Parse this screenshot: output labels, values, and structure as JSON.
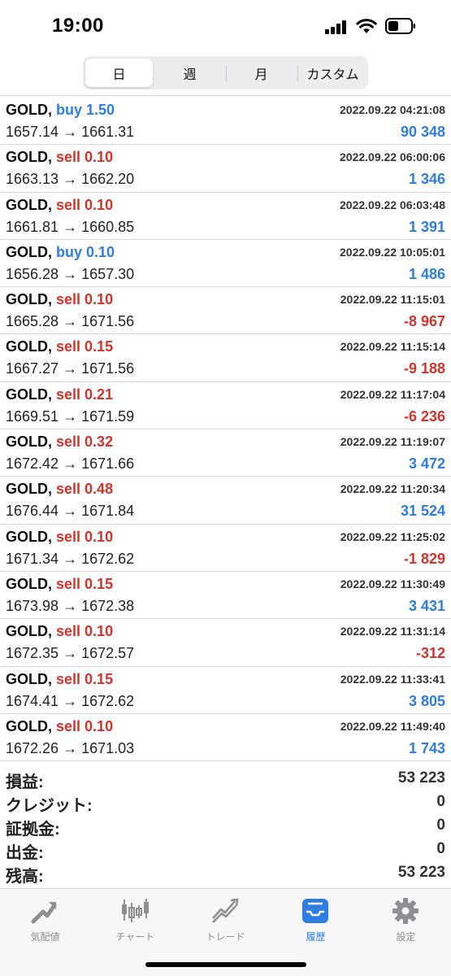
{
  "status": {
    "time": "19:00"
  },
  "period_tabs": [
    {
      "label": "日",
      "active": true
    },
    {
      "label": "週",
      "active": false
    },
    {
      "label": "月",
      "active": false
    },
    {
      "label": "カスタム",
      "active": false
    }
  ],
  "deals": [
    {
      "symbol": "GOLD,",
      "type": "buy",
      "volume": "buy 1.50",
      "prices": "1657.14 → 1661.31",
      "time": "2022.09.22 04:21:08",
      "profit": "90 348",
      "sign": "pos"
    },
    {
      "symbol": "GOLD,",
      "type": "sell",
      "volume": "sell 0.10",
      "prices": "1663.13 → 1662.20",
      "time": "2022.09.22 06:00:06",
      "profit": "1 346",
      "sign": "pos"
    },
    {
      "symbol": "GOLD,",
      "type": "sell",
      "volume": "sell 0.10",
      "prices": "1661.81 → 1660.85",
      "time": "2022.09.22 06:03:48",
      "profit": "1 391",
      "sign": "pos"
    },
    {
      "symbol": "GOLD,",
      "type": "buy",
      "volume": "buy 0.10",
      "prices": "1656.28 → 1657.30",
      "time": "2022.09.22 10:05:01",
      "profit": "1 486",
      "sign": "pos"
    },
    {
      "symbol": "GOLD,",
      "type": "sell",
      "volume": "sell 0.10",
      "prices": "1665.28 → 1671.56",
      "time": "2022.09.22 11:15:01",
      "profit": "-8 967",
      "sign": "neg"
    },
    {
      "symbol": "GOLD,",
      "type": "sell",
      "volume": "sell 0.15",
      "prices": "1667.27 → 1671.56",
      "time": "2022.09.22 11:15:14",
      "profit": "-9 188",
      "sign": "neg"
    },
    {
      "symbol": "GOLD,",
      "type": "sell",
      "volume": "sell 0.21",
      "prices": "1669.51 → 1671.59",
      "time": "2022.09.22 11:17:04",
      "profit": "-6 236",
      "sign": "neg"
    },
    {
      "symbol": "GOLD,",
      "type": "sell",
      "volume": "sell 0.32",
      "prices": "1672.42 → 1671.66",
      "time": "2022.09.22 11:19:07",
      "profit": "3 472",
      "sign": "pos"
    },
    {
      "symbol": "GOLD,",
      "type": "sell",
      "volume": "sell 0.48",
      "prices": "1676.44 → 1671.84",
      "time": "2022.09.22 11:20:34",
      "profit": "31 524",
      "sign": "pos"
    },
    {
      "symbol": "GOLD,",
      "type": "sell",
      "volume": "sell 0.10",
      "prices": "1671.34 → 1672.62",
      "time": "2022.09.22 11:25:02",
      "profit": "-1 829",
      "sign": "neg"
    },
    {
      "symbol": "GOLD,",
      "type": "sell",
      "volume": "sell 0.15",
      "prices": "1673.98 → 1672.38",
      "time": "2022.09.22 11:30:49",
      "profit": "3 431",
      "sign": "pos"
    },
    {
      "symbol": "GOLD,",
      "type": "sell",
      "volume": "sell 0.10",
      "prices": "1672.35 → 1672.57",
      "time": "2022.09.22 11:31:14",
      "profit": "-312",
      "sign": "neg"
    },
    {
      "symbol": "GOLD,",
      "type": "sell",
      "volume": "sell 0.15",
      "prices": "1674.41 → 1672.62",
      "time": "2022.09.22 11:33:41",
      "profit": "3 805",
      "sign": "pos"
    },
    {
      "symbol": "GOLD,",
      "type": "sell",
      "volume": "sell 0.10",
      "prices": "1672.26 → 1671.03",
      "time": "2022.09.22 11:49:40",
      "profit": "1 743",
      "sign": "pos"
    }
  ],
  "summary": [
    {
      "label": "損益:",
      "value": "53 223"
    },
    {
      "label": "クレジット:",
      "value": "0"
    },
    {
      "label": "証拠金:",
      "value": "0"
    },
    {
      "label": "出金:",
      "value": "0"
    },
    {
      "label": "残高:",
      "value": "53 223"
    }
  ],
  "tab_bar": [
    {
      "label": "気配値",
      "icon": "quotes-arrow-icon",
      "active": false
    },
    {
      "label": "チャート",
      "icon": "candlestick-chart-icon",
      "active": false
    },
    {
      "label": "トレード",
      "icon": "trade-line-icon",
      "active": false
    },
    {
      "label": "履歴",
      "icon": "history-inbox-icon",
      "active": true
    },
    {
      "label": "設定",
      "icon": "gear-icon",
      "active": false
    }
  ],
  "colors": {
    "accent": "#2f7de1",
    "buy": "#2f7de1",
    "sell": "#d2342c",
    "loss": "#d2342c"
  }
}
